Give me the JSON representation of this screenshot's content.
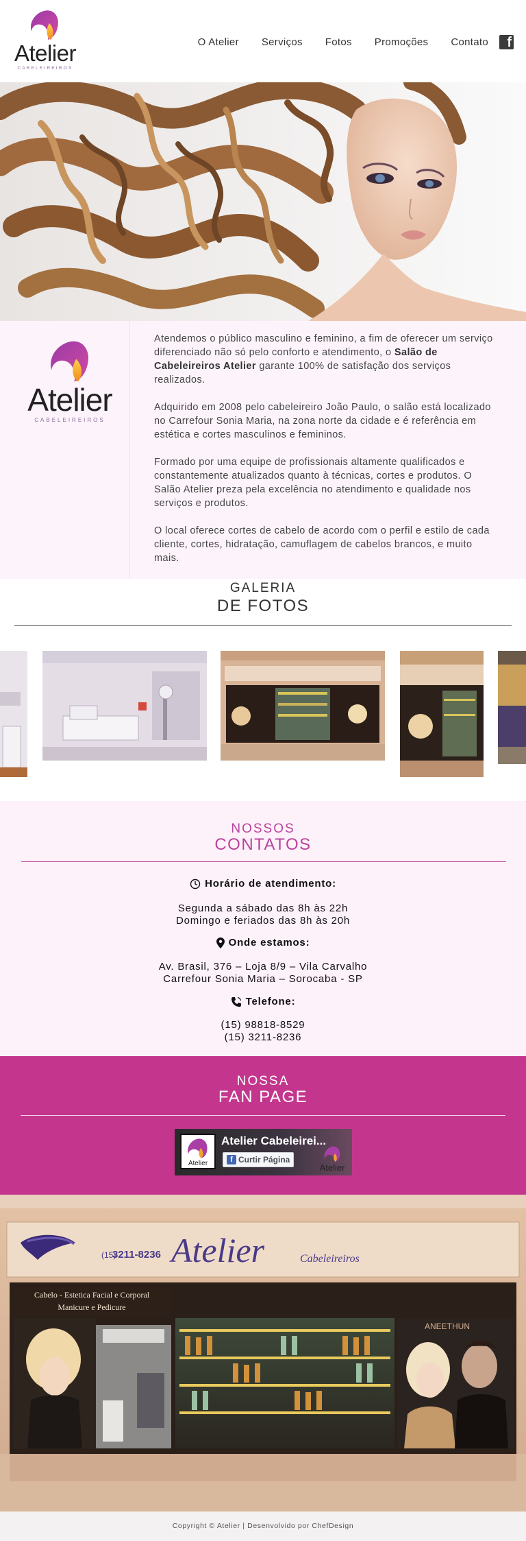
{
  "header": {
    "logo": {
      "word": "Atelier",
      "sub": "CABELEIREIROS"
    },
    "nav": [
      {
        "label": "O Atelier"
      },
      {
        "label": "Serviços"
      },
      {
        "label": "Fotos"
      },
      {
        "label": "Promoções"
      },
      {
        "label": "Contato"
      }
    ],
    "facebook_icon": "facebook-icon"
  },
  "about": {
    "logo": {
      "word": "Atelier",
      "sub": "CABELEIREIROS"
    },
    "p1_before": "Atendemos o público masculino e feminino, a fim de oferecer um serviço diferenciado não só pelo conforto e atendimento, o ",
    "p1_bold": "Salão de Cabeleireiros Atelier",
    "p1_after": " garante 100% de satisfação dos serviços realizados.",
    "p2": "Adquirido em 2008 pelo cabeleireiro João Paulo, o salão está localizado no Carrefour Sonia Maria, na zona norte da cidade e é referência em estética e cortes masculinos e femininos.",
    "p3": "Formado por uma equipe de profissionais altamente qualificados e constantemente atualizados quanto à técnicas, cortes e produtos. O Salão Atelier preza pela excelência no atendimento e qualidade nos serviços e produtos.",
    "p4": "O local oferece cortes de cabelo de acordo com o perfil e estilo de cada cliente, cortes, hidratação, camuflagem de cabelos brancos, e muito mais."
  },
  "gallery": {
    "title1": "GALERIA",
    "title2": "DE FOTOS"
  },
  "contacts": {
    "title1": "NOSSOS",
    "title2": "CONTATOS",
    "hours_label": "Horário de atendimento:",
    "hours_line1": "Segunda a sábado das 8h às 22h",
    "hours_line2": "Domingo e feriados das 8h às 20h",
    "location_label": "Onde estamos:",
    "address_line1": "Av. Brasil, 376 – Loja 8/9 – Vila Carvalho",
    "address_line2": "Carrefour Sonia Maria – Sorocaba - SP",
    "phone_label": "Telefone:",
    "phone1": "(15) 98818-8529",
    "phone2": "(15) 3211-8236"
  },
  "fanpage": {
    "title1": "NOSSA",
    "title2": "FAN PAGE",
    "page_name": "Atelier Cabeleirei...",
    "like_button": "Curtir Página"
  },
  "storefront": {
    "phone_sign": "3211-8236",
    "phone_prefix": "(15)",
    "brand_sign": "Atelier",
    "brand_sub": "Cabeleireiros",
    "banner_line1": "Cabelo - Estetica Facial e Corporal",
    "banner_line2": "Manicure e Pedicure",
    "right_brand": "ANEETHUN"
  },
  "footer": {
    "text": "Copyright © Atelier | Desenvolvido por ChefDesign"
  },
  "colors": {
    "accent": "#c4368e",
    "accent_text": "#b8449c",
    "contacts_bg": "#fdf1fa",
    "about_bg": "#fdf4fb"
  }
}
